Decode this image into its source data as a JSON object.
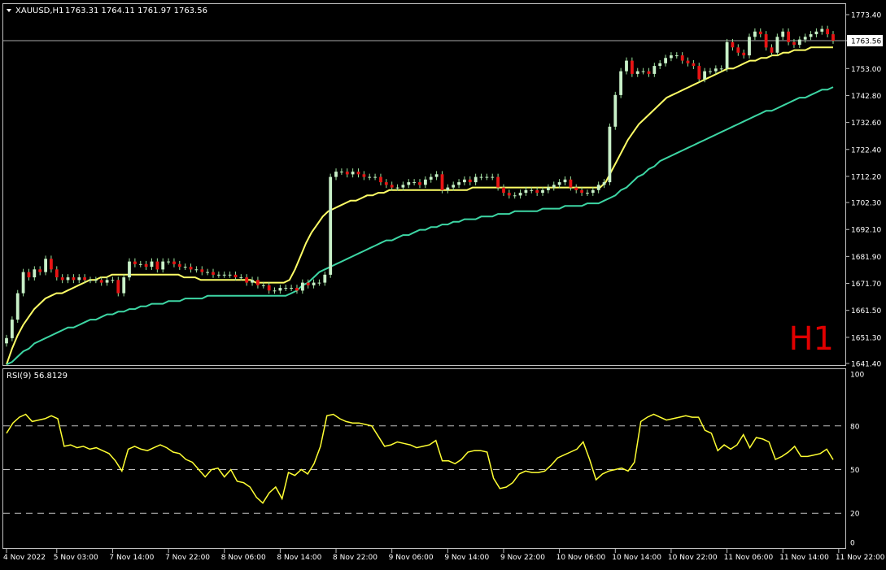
{
  "header": {
    "symbol": "XAUUSD,H1",
    "ohlc": "1763.31 1764.11 1761.97 1763.56"
  },
  "watermark": "H1",
  "colors": {
    "background": "#000000",
    "bull_candle": "#c8f0c8",
    "bear_candle": "#e81414",
    "wick": "#9adf9a",
    "ma_fast": "#ffff66",
    "ma_slow": "#3dd6a4",
    "rsi_line": "#ffff33",
    "grid_dash": "#c0c0c0",
    "frame": "#c0c0c0",
    "text": "#ffffff",
    "watermark": "#e00000",
    "price_line": "#a8a8a8"
  },
  "chart_data": [
    {
      "type": "candlestick",
      "panel": "main",
      "symbol": "XAUUSD",
      "timeframe": "H1",
      "current_price": 1763.56,
      "current_price_label": "1763.56",
      "ylim": [
        1640,
        1776
      ],
      "y_ticks": [
        1773.4,
        1763.56,
        1753.0,
        1742.8,
        1732.6,
        1722.4,
        1712.2,
        1702.3,
        1692.1,
        1681.9,
        1671.7,
        1661.5,
        1651.3,
        1641.4
      ],
      "y_tick_labels": [
        "1773.40",
        "1763.56",
        "1753.00",
        "1742.80",
        "1732.60",
        "1722.40",
        "1712.20",
        "1702.30",
        "1692.10",
        "1681.90",
        "1671.70",
        "1661.50",
        "1651.30",
        "1641.40"
      ],
      "x_labels": [
        "4 Nov 2022",
        "5 Nov 03:00",
        "7 Nov 14:00",
        "7 Nov 22:00",
        "8 Nov 06:00",
        "8 Nov 14:00",
        "8 Nov 22:00",
        "9 Nov 06:00",
        "9 Nov 14:00",
        "9 Nov 22:00",
        "10 Nov 06:00",
        "10 Nov 14:00",
        "10 Nov 22:00",
        "11 Nov 06:00",
        "11 Nov 14:00",
        "11 Nov 22:00"
      ],
      "x_label_bars": [
        0,
        9,
        19,
        29,
        39,
        49,
        59,
        69,
        79,
        89,
        99,
        109,
        119,
        129,
        139,
        149
      ],
      "close": [
        1651,
        1658,
        1668,
        1676,
        1674,
        1677,
        1676,
        1681,
        1677,
        1674,
        1673,
        1674,
        1673,
        1674,
        1673,
        1673,
        1673,
        1672,
        1673,
        1673,
        1668,
        1674,
        1680,
        1679,
        1679,
        1678,
        1680,
        1677,
        1680,
        1680,
        1679,
        1678,
        1678,
        1677,
        1677,
        1676,
        1676,
        1675,
        1675,
        1675,
        1675,
        1674,
        1674,
        1672,
        1673,
        1671,
        1671,
        1669,
        1669,
        1670,
        1670,
        1670,
        1669,
        1672,
        1671,
        1672,
        1672,
        1675,
        1712,
        1714,
        1714,
        1713,
        1714,
        1713,
        1712,
        1712,
        1712,
        1710,
        1709,
        1708,
        1708,
        1709,
        1710,
        1710,
        1709,
        1711,
        1712,
        1713,
        1707,
        1708,
        1709,
        1710,
        1711,
        1710,
        1712,
        1712,
        1712,
        1712,
        1708,
        1706,
        1705,
        1705,
        1706,
        1707,
        1707,
        1706,
        1707,
        1708,
        1709,
        1710,
        1711,
        1708,
        1707,
        1706,
        1706,
        1707,
        1709,
        1710,
        1731,
        1743,
        1752,
        1756,
        1751,
        1752,
        1752,
        1751,
        1754,
        1755,
        1757,
        1758,
        1758,
        1756,
        1755,
        1754,
        1749,
        1752,
        1752,
        1753,
        1753,
        1763,
        1761,
        1759,
        1758,
        1765,
        1767,
        1766,
        1761,
        1759,
        1765,
        1767,
        1763,
        1762,
        1764,
        1765,
        1766,
        1767,
        1768,
        1766,
        1763.56
      ],
      "series": [
        {
          "name": "ma_fast",
          "color": "#ffff66",
          "values": [
            1641,
            1647,
            1652,
            1656,
            1659,
            1662,
            1664,
            1666,
            1667,
            1668,
            1668,
            1669,
            1670,
            1671,
            1672,
            1673,
            1673,
            1674,
            1674,
            1675,
            1675,
            1675,
            1675,
            1675,
            1675,
            1675,
            1675,
            1675,
            1675,
            1675,
            1675,
            1675,
            1674,
            1674,
            1674,
            1673,
            1673,
            1673,
            1673,
            1673,
            1673,
            1673,
            1673,
            1673,
            1673,
            1672,
            1672,
            1672,
            1672,
            1672,
            1672,
            1673,
            1677,
            1682,
            1687,
            1691,
            1694,
            1697,
            1699,
            1700,
            1701,
            1702,
            1703,
            1703,
            1704,
            1705,
            1705,
            1706,
            1706,
            1707,
            1707,
            1707,
            1707,
            1707,
            1707,
            1707,
            1707,
            1707,
            1707,
            1707,
            1707,
            1707,
            1707,
            1707,
            1708,
            1708,
            1708,
            1708,
            1708,
            1708,
            1708,
            1708,
            1708,
            1708,
            1708,
            1708,
            1708,
            1708,
            1708,
            1708,
            1708,
            1708,
            1708,
            1708,
            1708,
            1708,
            1708,
            1708,
            1710,
            1714,
            1718,
            1722,
            1726,
            1729,
            1732,
            1734,
            1736,
            1738,
            1740,
            1742,
            1743,
            1744,
            1745,
            1746,
            1747,
            1748,
            1749,
            1750,
            1751,
            1752,
            1753,
            1753,
            1754,
            1755,
            1756,
            1756,
            1757,
            1757,
            1758,
            1758,
            1759,
            1759,
            1760,
            1760,
            1760,
            1761,
            1761,
            1761,
            1761,
            1761
          ]
        },
        {
          "name": "ma_slow",
          "color": "#3dd6a4",
          "values": [
            1641,
            1642,
            1644,
            1646,
            1647,
            1649,
            1650,
            1651,
            1652,
            1653,
            1654,
            1655,
            1655,
            1656,
            1657,
            1658,
            1658,
            1659,
            1660,
            1660,
            1661,
            1661,
            1662,
            1662,
            1663,
            1663,
            1664,
            1664,
            1664,
            1665,
            1665,
            1665,
            1666,
            1666,
            1666,
            1666,
            1667,
            1667,
            1667,
            1667,
            1667,
            1667,
            1667,
            1667,
            1667,
            1667,
            1667,
            1667,
            1667,
            1667,
            1667,
            1668,
            1669,
            1671,
            1672,
            1674,
            1676,
            1677,
            1678,
            1679,
            1680,
            1681,
            1682,
            1683,
            1684,
            1685,
            1686,
            1687,
            1688,
            1688,
            1689,
            1690,
            1690,
            1691,
            1692,
            1692,
            1693,
            1693,
            1694,
            1694,
            1695,
            1695,
            1696,
            1696,
            1696,
            1697,
            1697,
            1697,
            1698,
            1698,
            1698,
            1699,
            1699,
            1699,
            1699,
            1699,
            1700,
            1700,
            1700,
            1700,
            1701,
            1701,
            1701,
            1701,
            1702,
            1702,
            1702,
            1703,
            1704,
            1705,
            1707,
            1708,
            1710,
            1712,
            1713,
            1715,
            1716,
            1718,
            1719,
            1720,
            1721,
            1722,
            1723,
            1724,
            1725,
            1726,
            1727,
            1728,
            1729,
            1730,
            1731,
            1732,
            1733,
            1734,
            1735,
            1736,
            1737,
            1737,
            1738,
            1739,
            1740,
            1741,
            1742,
            1742,
            1743,
            1744,
            1745,
            1745,
            1746
          ]
        }
      ]
    },
    {
      "type": "line",
      "panel": "rsi",
      "label": "RSI(9) 56.8129",
      "ylim": [
        0,
        100
      ],
      "y_ticks": [
        100,
        80,
        50,
        20,
        0
      ],
      "levels": [
        80,
        50,
        20
      ],
      "series": [
        {
          "name": "RSI(9)",
          "color": "#ffff33",
          "values": [
            75,
            82,
            86,
            88,
            83,
            84,
            85,
            87,
            85,
            66,
            67,
            65,
            66,
            64,
            65,
            63,
            61,
            56,
            49,
            64,
            66,
            64,
            63,
            65,
            67,
            65,
            62,
            61,
            57,
            55,
            50,
            45,
            50,
            51,
            45,
            50,
            42,
            41,
            38,
            31,
            27,
            34,
            38,
            30,
            48,
            46,
            50,
            47,
            54,
            66,
            87,
            88,
            85,
            83,
            82,
            82,
            81,
            80,
            73,
            66,
            67,
            69,
            68,
            67,
            65,
            66,
            67,
            70,
            56,
            56,
            54,
            57,
            62,
            63,
            63,
            62,
            44,
            37,
            38,
            41,
            47,
            49,
            48,
            48,
            49,
            53,
            58,
            60,
            62,
            64,
            69,
            57,
            43,
            47,
            49,
            50,
            51,
            49,
            55,
            83,
            86,
            88,
            86,
            84,
            85,
            86,
            87,
            86,
            86,
            77,
            75,
            63,
            67,
            64,
            67,
            74,
            65,
            72,
            71,
            69,
            57,
            59,
            62,
            66,
            59,
            59,
            60,
            61,
            64,
            56.8
          ]
        }
      ]
    }
  ]
}
